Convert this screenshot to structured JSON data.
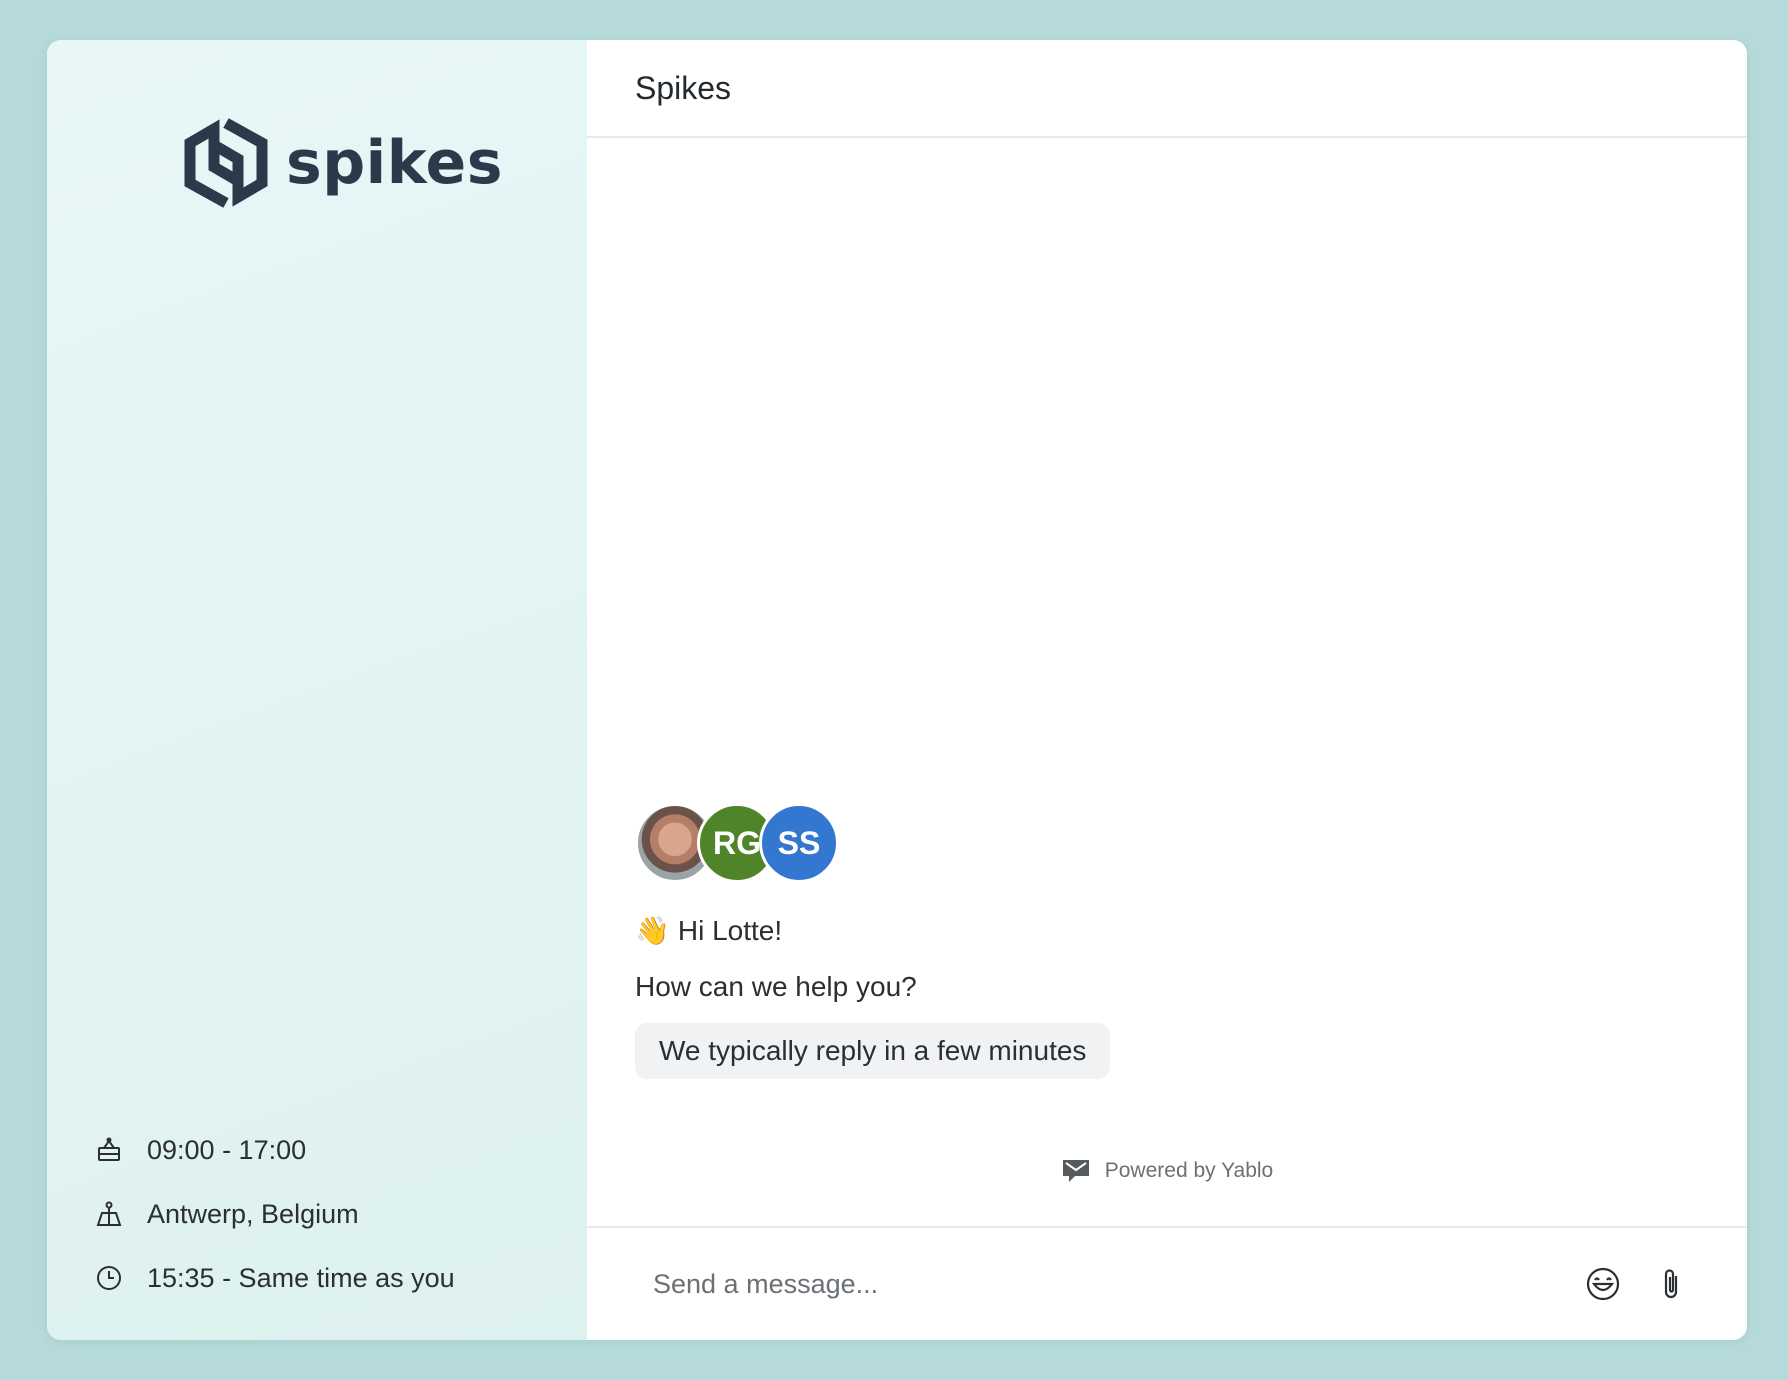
{
  "brand": {
    "name": "spikes"
  },
  "sidebar": {
    "info": [
      {
        "icon": "office-hours-icon",
        "text": "09:00 - 17:00"
      },
      {
        "icon": "location-icon",
        "text": "Antwerp, Belgium"
      },
      {
        "icon": "clock-icon",
        "text": "15:35 - Same time as you"
      }
    ]
  },
  "header": {
    "title": "Spikes"
  },
  "team": {
    "avatars": [
      {
        "type": "photo"
      },
      {
        "initials": "RG",
        "color": "#4f8428"
      },
      {
        "initials": "SS",
        "color": "#3477d1"
      }
    ]
  },
  "welcome": {
    "wave": "👋",
    "greeting": "Hi Lotte!",
    "question": "How can we help you?",
    "reply_time": "We typically reply in a few minutes"
  },
  "footer": {
    "powered_by": "Powered by Yablo"
  },
  "composer": {
    "placeholder": "Send a message..."
  },
  "colors": {
    "background": "#b5dad9",
    "sidebar": "#e2f3f3",
    "accent_green": "#4f8428",
    "accent_blue": "#3477d1"
  }
}
